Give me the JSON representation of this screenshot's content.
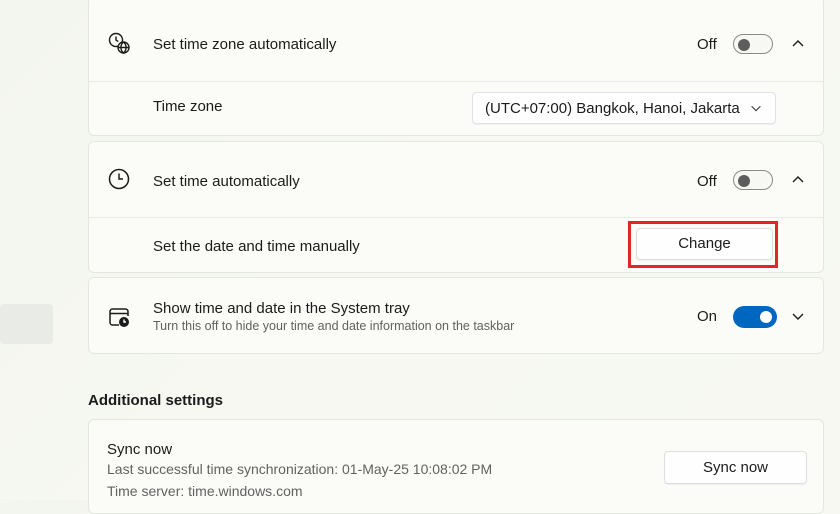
{
  "time_zone_card": {
    "set_auto_label": "Set time zone automatically",
    "set_auto_state": "Off",
    "time_zone_label": "Time zone",
    "time_zone_value": "(UTC+07:00) Bangkok, Hanoi, Jakarta"
  },
  "set_time_card": {
    "set_auto_label": "Set time automatically",
    "set_auto_state": "Off",
    "manual_label": "Set the date and time manually",
    "change_button": "Change"
  },
  "tray_card": {
    "title": "Show time and date in the System tray",
    "subtitle": "Turn this off to hide your time and date information on the taskbar",
    "state": "On"
  },
  "additional": {
    "section_title": "Additional settings",
    "sync_title": "Sync now",
    "last_sync": "Last successful time synchronization: 01-May-25 10:08:02 PM",
    "time_server": "Time server: time.windows.com",
    "sync_button": "Sync now"
  },
  "colors": {
    "accent": "#0067c0",
    "highlight": "#e0262b"
  },
  "icons": [
    "globe-clock-icon",
    "clock-icon",
    "calendar-clock-icon",
    "chevron-up-icon",
    "chevron-down-icon"
  ]
}
